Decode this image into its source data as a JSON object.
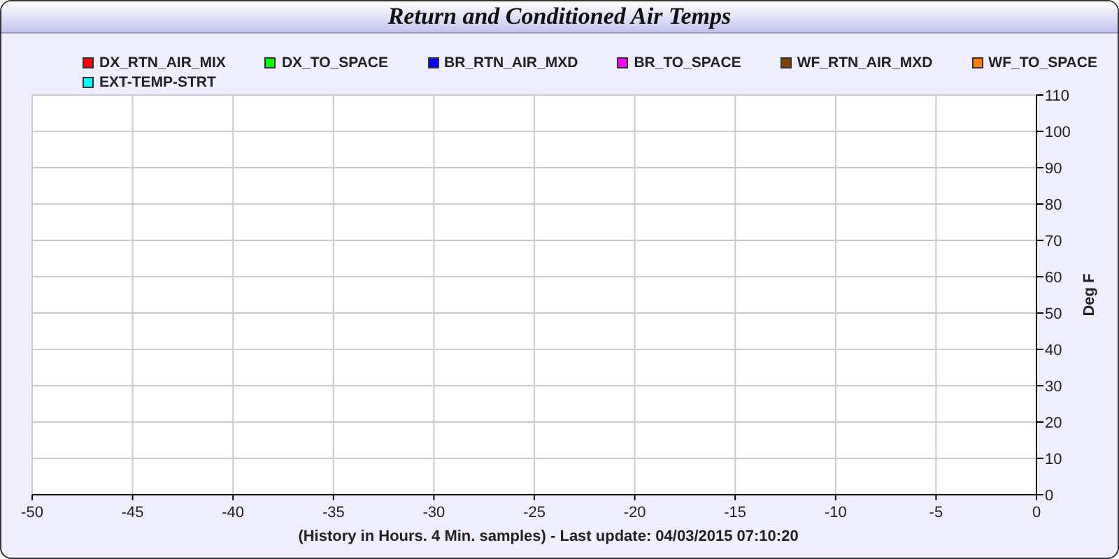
{
  "window": {
    "title": "Return and Conditioned Air Temps"
  },
  "chart_data": {
    "type": "line",
    "xlabel": "(History in Hours. 4 Min. samples) - Last update: 04/03/2015 07:10:20",
    "ylabel": "Deg F",
    "ylim": [
      0,
      110
    ],
    "grid": true,
    "categories": [
      "-50",
      "-45",
      "-40",
      "-35",
      "-30",
      "-25",
      "-20",
      "-15",
      "-10",
      "-5",
      "0"
    ],
    "yticks": [
      0,
      10,
      20,
      30,
      40,
      50,
      60,
      70,
      80,
      90,
      100,
      110
    ],
    "series": [
      {
        "name": "DX_RTN_AIR_MIX",
        "color": "#ff0000",
        "values": [
          null,
          null,
          null,
          null,
          null,
          null,
          null,
          null,
          null,
          null,
          null
        ]
      },
      {
        "name": "DX_TO_SPACE",
        "color": "#00ff00",
        "values": [
          null,
          null,
          null,
          null,
          null,
          null,
          null,
          null,
          null,
          null,
          null
        ]
      },
      {
        "name": "BR_RTN_AIR_MXD",
        "color": "#0000ff",
        "values": [
          null,
          null,
          null,
          null,
          null,
          null,
          null,
          null,
          null,
          null,
          null
        ]
      },
      {
        "name": "BR_TO_SPACE",
        "color": "#ff00ff",
        "values": [
          null,
          null,
          null,
          null,
          null,
          null,
          null,
          null,
          null,
          null,
          null
        ]
      },
      {
        "name": "WF_RTN_AIR_MXD",
        "color": "#804000",
        "values": [
          null,
          null,
          null,
          null,
          null,
          null,
          null,
          null,
          null,
          null,
          null
        ]
      },
      {
        "name": "WF_TO_SPACE",
        "color": "#ff8000",
        "values": [
          null,
          null,
          null,
          null,
          null,
          null,
          null,
          null,
          null,
          null,
          null
        ]
      },
      {
        "name": "EXT-TEMP-STRT",
        "color": "#00ffff",
        "values": [
          null,
          null,
          null,
          null,
          null,
          null,
          null,
          null,
          null,
          null,
          null
        ]
      }
    ]
  }
}
